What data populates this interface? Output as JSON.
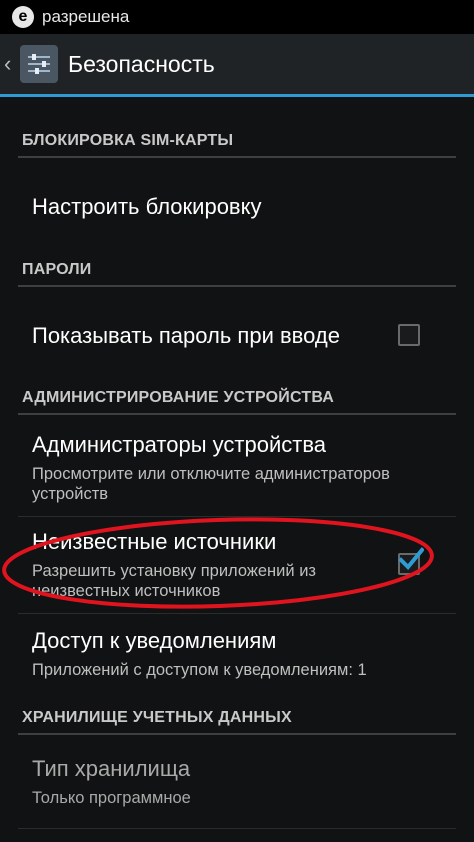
{
  "statusbar": {
    "icon_letter": "e",
    "text": "разрешена"
  },
  "actionbar": {
    "title": "Безопасность",
    "icon": "settings-sliders-icon"
  },
  "sections": {
    "sim": {
      "header": "БЛОКИРОВКА SIM-КАРТЫ",
      "item_title": "Настроить блокировку"
    },
    "passwords": {
      "header": "ПАРОЛИ",
      "item_title": "Показывать пароль при вводе",
      "checked": false
    },
    "admin": {
      "header": "АДМИНИСТРИРОВАНИЕ УСТРОЙСТВА",
      "admins_title": "Администраторы устройства",
      "admins_sub": "Просмотрите или отключите администраторов устройств",
      "unknown_title": "Неизвестные источники",
      "unknown_sub": "Разрешить установку приложений из неизвестных источников",
      "unknown_checked": true,
      "notify_title": "Доступ к уведомлениям",
      "notify_sub": "Приложений с доступом к уведомлениям: 1"
    },
    "storage": {
      "header": "ХРАНИЛИЩЕ УЧЕТНЫХ ДАННЫХ",
      "type_title": "Тип хранилища",
      "type_sub": "Только программное"
    }
  },
  "colors": {
    "accent": "#2f9bd3",
    "annotation": "#e0141e"
  }
}
